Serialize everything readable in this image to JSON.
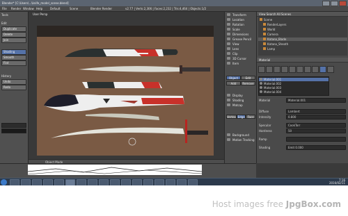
{
  "window": {
    "title": "Blender* [C:\\Users\\...\\knife_model_scene.blend]",
    "infobar_items": [
      "File",
      "Render",
      "Window",
      "Help",
      "Default",
      "Scene",
      "Blender Render",
      "v2.77 | Verts:2,306 | Faces:2,232 | Tris:4,464 | Objects:1/2"
    ]
  },
  "left_panel": {
    "header": "Tools",
    "section1": "Edit",
    "buttons": [
      "Duplicate",
      "Delete",
      "Join",
      "Shading",
      "Smooth",
      "Flat"
    ],
    "section2": "History",
    "history_buttons": [
      "Undo",
      "Redo"
    ]
  },
  "viewport": {
    "title": "User Persp",
    "header_label": "Object Mode"
  },
  "middle_panel": {
    "items": [
      "Transform",
      "Location",
      "Rotation",
      "Scale",
      "Dimensions",
      "Grease Pencil",
      "View",
      "Lens",
      "Clip",
      "3D Cursor",
      "Item",
      "Display",
      "Shading",
      "Matcap",
      "Background",
      "Motion Tracking"
    ],
    "tabs": [
      "Object",
      "Edit"
    ],
    "tabs2": [
      "Add",
      "Remove"
    ],
    "fields": [
      "Vertex",
      "Edge",
      "Face"
    ]
  },
  "right_panel": {
    "outliner_header": "View  Search  All Scenes",
    "outliner_rows": [
      {
        "label": "Scene",
        "indent": 0
      },
      {
        "label": "RenderLayers",
        "indent": 1
      },
      {
        "label": "World",
        "indent": 1
      },
      {
        "label": "Camera",
        "indent": 1
      },
      {
        "label": "Katana_Blade",
        "indent": 1
      },
      {
        "label": "Katana_Sheath",
        "indent": 1
      },
      {
        "label": "Lamp",
        "indent": 1
      }
    ],
    "material_header": "Material",
    "slots": [
      "Material.001",
      "Material.002",
      "Material.003",
      "Material.004"
    ],
    "selected_slot": "Material.001",
    "props": [
      {
        "label": "Diffuse",
        "value": "Lambert"
      },
      {
        "label": "Intensity",
        "value": "0.800"
      },
      {
        "label": "Specular",
        "value": "CookTorr"
      },
      {
        "label": "Hardness",
        "value": "50"
      },
      {
        "label": "Ramp",
        "value": ""
      },
      {
        "label": "Shading",
        "value": "Emit 0.000"
      }
    ]
  },
  "taskbar": {
    "time": "7:16",
    "date": "2016/02/11"
  },
  "footer": {
    "brand_prefix": "Host images free ",
    "brand_name": "JpgBox.com"
  },
  "colors": {
    "accent": "#5572a8",
    "panel": "#4a4a4a"
  }
}
